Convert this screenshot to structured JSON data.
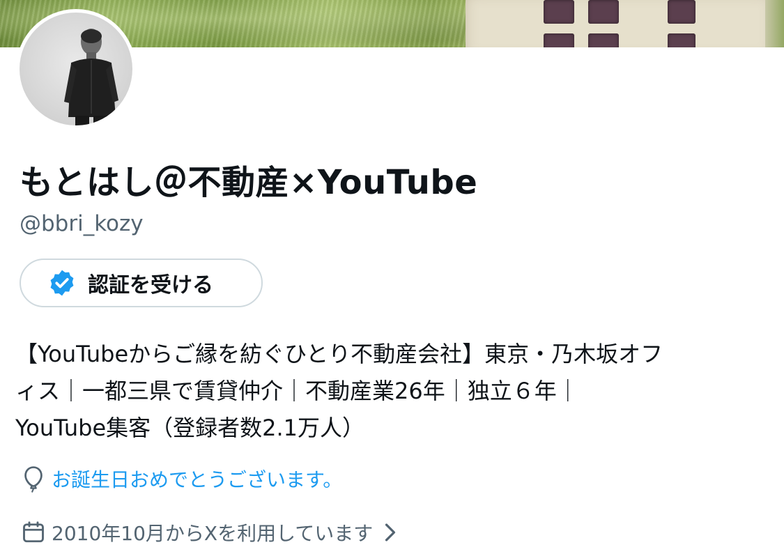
{
  "profile": {
    "display_name": "もとはし＠不動産×YouTube",
    "handle": "@bbri_kozy",
    "verify_button_label": "認証を受ける",
    "bio_lines": [
      "【YouTubeからご縁を紡ぐひとり不動産会社】東京・乃木坂オフ",
      "ィス｜一都三県で賃貸仲介｜不動産業26年｜独立６年｜",
      "YouTube集客（登録者数2.1万人）"
    ],
    "birthday_text": "お誕生日おめでとうございます。",
    "joined_text": "2010年10月からXを利用しています"
  },
  "icons": {
    "verify": "verified-badge-icon",
    "birthday": "balloon-icon",
    "joined": "calendar-icon",
    "chevron": "chevron-right-icon"
  },
  "colors": {
    "accent": "#1d9bf0",
    "text_primary": "#0f1419",
    "text_secondary": "#536471",
    "border": "#cfd9de"
  }
}
